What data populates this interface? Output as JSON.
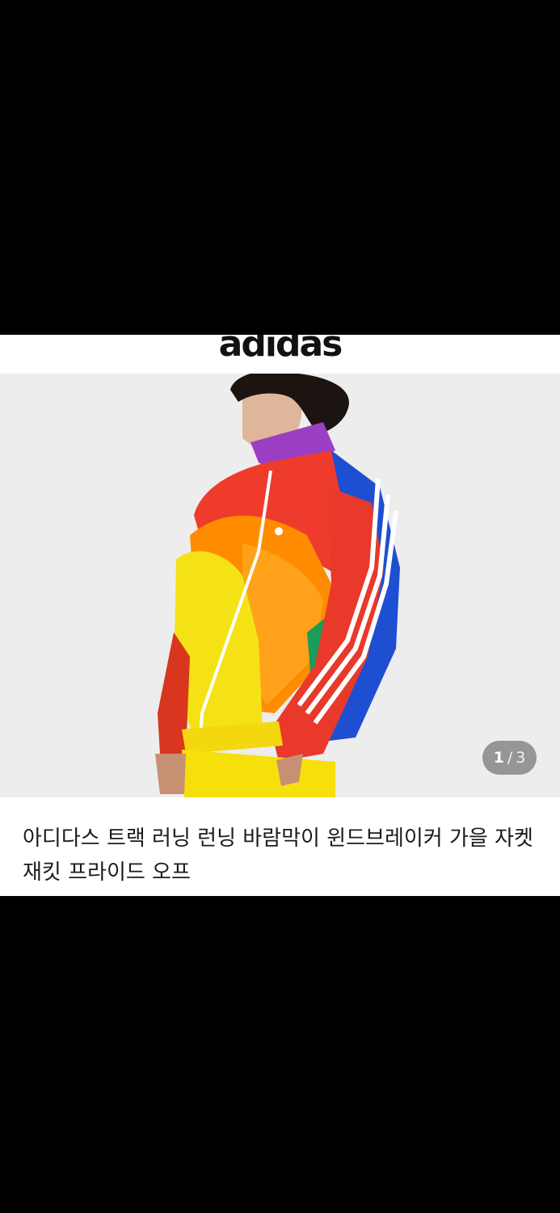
{
  "brand": {
    "logo_text": "adidas"
  },
  "product_image": {
    "icon": "rainbow-track-jacket-photo",
    "counter": {
      "current": "1",
      "separator": "/",
      "total": "3"
    }
  },
  "product": {
    "title": "아디다스 트랙 러닝 런닝 바람막이 윈드브레이커 가을 자켓 재킷 프라이드 오프"
  },
  "colors": {
    "jacket_purple": "#9b3fc2",
    "jacket_red": "#ef3b2c",
    "jacket_orange": "#ff8c00",
    "jacket_yellow": "#f4e216",
    "jacket_blue": "#1f4fd1",
    "background": "#ededee"
  }
}
